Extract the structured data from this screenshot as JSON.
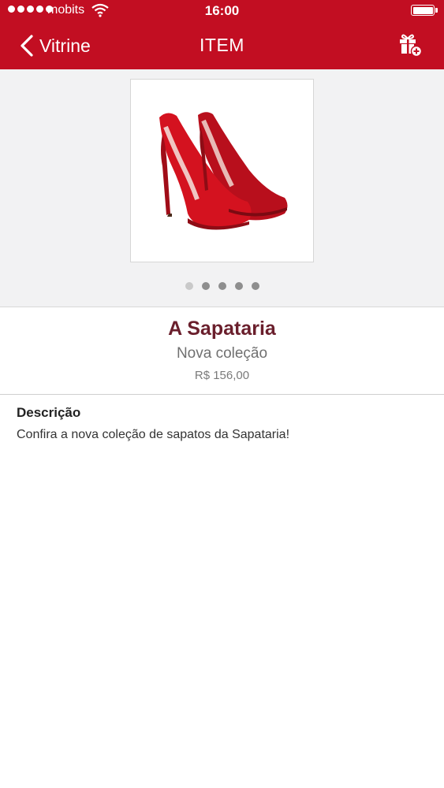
{
  "status": {
    "carrier": "mobits",
    "time": "16:00"
  },
  "nav": {
    "back_label": "Vitrine",
    "title": "ITEM"
  },
  "gallery": {
    "image_count": 5,
    "active_index": 0
  },
  "item": {
    "name": "A Sapataria",
    "subtitle": "Nova coleção",
    "price": "R$ 156,00"
  },
  "description": {
    "heading": "Descrição",
    "text": "Confira a nova coleção de sapatos da Sapataria!"
  },
  "colors": {
    "header": "#c20e22",
    "name": "#6a1f2c",
    "shoe": "#d4121f"
  },
  "icons": {
    "back": "chevron-left-icon",
    "gift": "gift-add-icon",
    "wifi": "wifi-icon",
    "battery": "battery-icon"
  }
}
